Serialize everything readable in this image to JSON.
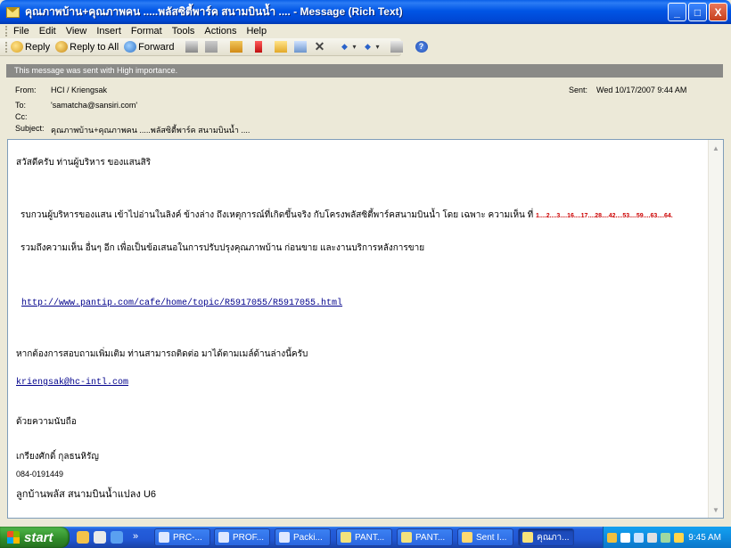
{
  "window": {
    "title": "คุณภาพบ้าน+คุณภาพคน .....พลัสซิตี้พาร์ค สนามบินน้ำ .... - Message (Rich Text)",
    "buttons": [
      "_",
      "□",
      "X"
    ]
  },
  "menubar": {
    "items": [
      "File",
      "Edit",
      "View",
      "Insert",
      "Format",
      "Tools",
      "Actions",
      "Help"
    ]
  },
  "toolbar": {
    "reply": "Reply",
    "reply_all": "Reply to All",
    "forward": "Forward",
    "icons": [
      "print-icon",
      "move-icon",
      "categorize-icon",
      "flag-icon",
      "folder-icon",
      "find-icon",
      "delete-icon",
      "previous-item-icon",
      "next-item-icon",
      "address-book-icon",
      "help-icon"
    ]
  },
  "message_header": {
    "importance_notice": "This message was sent with High importance.",
    "from_label": "From:",
    "from": "HCI / Kriengsak",
    "sent_label": "Sent:",
    "sent": "Wed 10/17/2007 9:44 AM",
    "to_label": "To:",
    "to": "'samatcha@sansiri.com'",
    "cc_label": "Cc:",
    "cc": "",
    "subject_label": "Subject:",
    "subject": "คุณภาพบ้าน+คุณภาพคน .....พลัสซิตี้พาร์ค สนามบินน้ำ ...."
  },
  "body": {
    "greeting": "สวัสดีครับ ท่านผู้บริหาร ของแสนสิริ",
    "para1": "รบกวนผู้บริหารของแสน เข้าไปอ่านในลิงค์ ข้างล่าง ถึงเหตุการณ์ที่เกิดขึ้นจริง กับโครงพลัสซิตี้พาร์คสนามบินน้ำ  โดย เฉพาะ ความเห็น ที่ ",
    "comment_numbers": "1....2....3....16....17....28....42....53....59....63....64.",
    "para2": "รวมถึงความเห็น  อื่นๆ อีก เพื่อเป็นข้อเสนอในการปรับปรุงคุณภาพบ้าน ก่อนขาย และงานบริการหลังการขาย",
    "link": "http://www.pantip.com/cafe/home/topic/R5917055/R5917055.html",
    "contact": "หากต้องการสอบถามเพิ่มเติม ท่านสามารถติดต่อ มาได้ตามเมล์ด้านล่างนี้ครับ",
    "email": "kriengsak@hc-intl.com",
    "closing": "ด้วยความนับถือ",
    "name": "เกรียงศักดิ์ กุลธนหิรัญ",
    "phone": "084-0191449",
    "customer": "ลูกบ้านพลัส สนามบินน้ำแปลง U6"
  },
  "taskbar": {
    "start": "start",
    "quick_launch_icons": [
      "ie-icon",
      "outlook-icon",
      "show-desktop-icon"
    ],
    "overflow": "»",
    "tasks": [
      {
        "label": "PRC-...",
        "icon": "word-doc-icon",
        "color": "#dfe8ff"
      },
      {
        "label": "PROF...",
        "icon": "word-doc-icon",
        "color": "#dfe8ff"
      },
      {
        "label": "Packi...",
        "icon": "word-doc-icon",
        "color": "#dfe8ff"
      },
      {
        "label": "PANT...",
        "icon": "browser-icon",
        "color": "#f3e27c"
      },
      {
        "label": "PANT...",
        "icon": "browser-icon",
        "color": "#f3e27c"
      },
      {
        "label": "Sent I...",
        "icon": "outlook-icon",
        "color": "#ffd970"
      },
      {
        "label": "คุณภา...",
        "icon": "message-icon",
        "color": "#f7e27a"
      }
    ],
    "clock": "9:45 AM"
  }
}
